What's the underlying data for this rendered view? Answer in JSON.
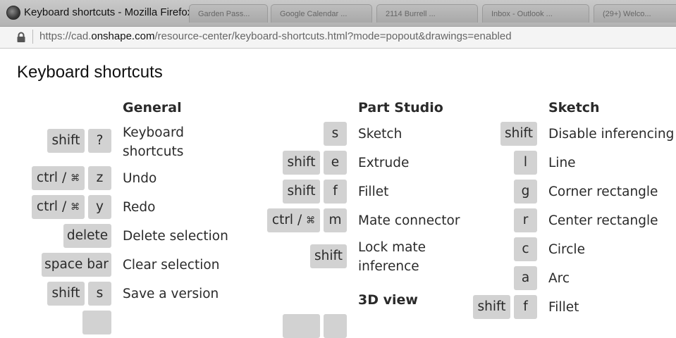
{
  "window": {
    "title": "Keyboard shortcuts - Mozilla Firefox",
    "background_tabs": [
      "Garden Pass...",
      "Google Calendar ...",
      "2114 Burrell ...",
      "Inbox - Outlook ...",
      "(29+) Welco..."
    ],
    "url_prefix": "https://cad.",
    "url_domain": "onshape.com",
    "url_suffix": "/resource-center/keyboard-shortcuts.html?mode=popout&drawings=enabled"
  },
  "page": {
    "title": "Keyboard shortcuts"
  },
  "general": {
    "heading": "General",
    "items": [
      {
        "keys": [
          "shift",
          "?"
        ],
        "label_line1": "Keyboard",
        "label_line2": "shortcuts"
      },
      {
        "keys": [
          "ctrl / ",
          "z"
        ],
        "cmd_symbol": "⌘",
        "label": "Undo"
      },
      {
        "keys": [
          "ctrl / ",
          "y"
        ],
        "cmd_symbol": "⌘",
        "label": "Redo"
      },
      {
        "keys": [
          "delete"
        ],
        "label": "Delete selection"
      },
      {
        "keys": [
          "space bar"
        ],
        "label": "Clear selection"
      },
      {
        "keys": [
          "shift",
          "s"
        ],
        "label": "Save a version"
      }
    ]
  },
  "part_studio": {
    "heading": "Part Studio",
    "items": [
      {
        "keys": [
          "s"
        ],
        "label": "Sketch"
      },
      {
        "keys": [
          "shift",
          "e"
        ],
        "label": "Extrude"
      },
      {
        "keys": [
          "shift",
          "f"
        ],
        "label": "Fillet"
      },
      {
        "keys": [
          "ctrl / ",
          "m"
        ],
        "cmd_symbol": "⌘",
        "label": "Mate connector"
      },
      {
        "keys": [
          "shift"
        ],
        "label_line1": "Lock mate",
        "label_line2": "inference"
      }
    ],
    "subheading": "3D view"
  },
  "sketch": {
    "heading": "Sketch",
    "items": [
      {
        "keys": [
          "shift"
        ],
        "label": "Disable inferencing"
      },
      {
        "keys": [
          "l"
        ],
        "label": "Line"
      },
      {
        "keys": [
          "g"
        ],
        "label": "Corner rectangle"
      },
      {
        "keys": [
          "r"
        ],
        "label": "Center rectangle"
      },
      {
        "keys": [
          "c"
        ],
        "label": "Circle"
      },
      {
        "keys": [
          "a"
        ],
        "label": "Arc"
      },
      {
        "keys": [
          "shift",
          "f"
        ],
        "label": "Fillet"
      }
    ]
  },
  "colors": {
    "key_bg": "#d2d2d2",
    "text": "#2a2a2a",
    "chrome": "#c2c2c2"
  }
}
